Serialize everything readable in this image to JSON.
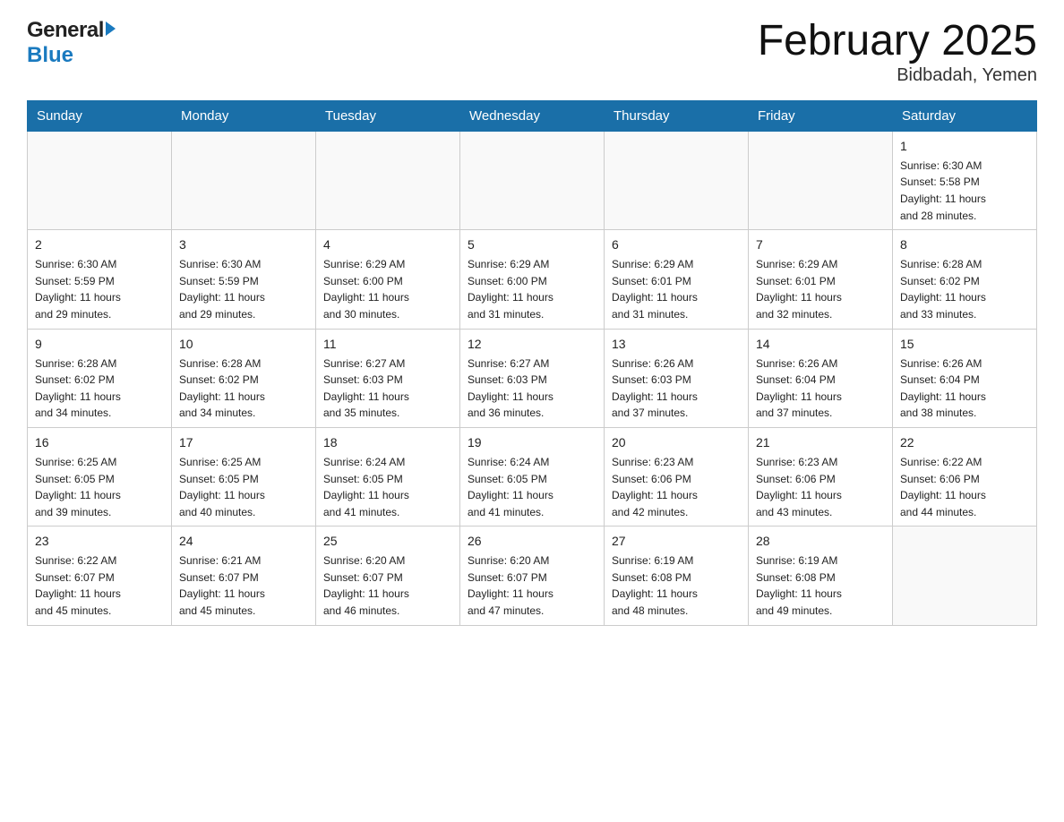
{
  "header": {
    "logo_general": "General",
    "logo_blue": "Blue",
    "month_title": "February 2025",
    "location": "Bidbadah, Yemen"
  },
  "weekdays": [
    "Sunday",
    "Monday",
    "Tuesday",
    "Wednesday",
    "Thursday",
    "Friday",
    "Saturday"
  ],
  "weeks": [
    [
      {
        "day": "",
        "info": ""
      },
      {
        "day": "",
        "info": ""
      },
      {
        "day": "",
        "info": ""
      },
      {
        "day": "",
        "info": ""
      },
      {
        "day": "",
        "info": ""
      },
      {
        "day": "",
        "info": ""
      },
      {
        "day": "1",
        "info": "Sunrise: 6:30 AM\nSunset: 5:58 PM\nDaylight: 11 hours\nand 28 minutes."
      }
    ],
    [
      {
        "day": "2",
        "info": "Sunrise: 6:30 AM\nSunset: 5:59 PM\nDaylight: 11 hours\nand 29 minutes."
      },
      {
        "day": "3",
        "info": "Sunrise: 6:30 AM\nSunset: 5:59 PM\nDaylight: 11 hours\nand 29 minutes."
      },
      {
        "day": "4",
        "info": "Sunrise: 6:29 AM\nSunset: 6:00 PM\nDaylight: 11 hours\nand 30 minutes."
      },
      {
        "day": "5",
        "info": "Sunrise: 6:29 AM\nSunset: 6:00 PM\nDaylight: 11 hours\nand 31 minutes."
      },
      {
        "day": "6",
        "info": "Sunrise: 6:29 AM\nSunset: 6:01 PM\nDaylight: 11 hours\nand 31 minutes."
      },
      {
        "day": "7",
        "info": "Sunrise: 6:29 AM\nSunset: 6:01 PM\nDaylight: 11 hours\nand 32 minutes."
      },
      {
        "day": "8",
        "info": "Sunrise: 6:28 AM\nSunset: 6:02 PM\nDaylight: 11 hours\nand 33 minutes."
      }
    ],
    [
      {
        "day": "9",
        "info": "Sunrise: 6:28 AM\nSunset: 6:02 PM\nDaylight: 11 hours\nand 34 minutes."
      },
      {
        "day": "10",
        "info": "Sunrise: 6:28 AM\nSunset: 6:02 PM\nDaylight: 11 hours\nand 34 minutes."
      },
      {
        "day": "11",
        "info": "Sunrise: 6:27 AM\nSunset: 6:03 PM\nDaylight: 11 hours\nand 35 minutes."
      },
      {
        "day": "12",
        "info": "Sunrise: 6:27 AM\nSunset: 6:03 PM\nDaylight: 11 hours\nand 36 minutes."
      },
      {
        "day": "13",
        "info": "Sunrise: 6:26 AM\nSunset: 6:03 PM\nDaylight: 11 hours\nand 37 minutes."
      },
      {
        "day": "14",
        "info": "Sunrise: 6:26 AM\nSunset: 6:04 PM\nDaylight: 11 hours\nand 37 minutes."
      },
      {
        "day": "15",
        "info": "Sunrise: 6:26 AM\nSunset: 6:04 PM\nDaylight: 11 hours\nand 38 minutes."
      }
    ],
    [
      {
        "day": "16",
        "info": "Sunrise: 6:25 AM\nSunset: 6:05 PM\nDaylight: 11 hours\nand 39 minutes."
      },
      {
        "day": "17",
        "info": "Sunrise: 6:25 AM\nSunset: 6:05 PM\nDaylight: 11 hours\nand 40 minutes."
      },
      {
        "day": "18",
        "info": "Sunrise: 6:24 AM\nSunset: 6:05 PM\nDaylight: 11 hours\nand 41 minutes."
      },
      {
        "day": "19",
        "info": "Sunrise: 6:24 AM\nSunset: 6:05 PM\nDaylight: 11 hours\nand 41 minutes."
      },
      {
        "day": "20",
        "info": "Sunrise: 6:23 AM\nSunset: 6:06 PM\nDaylight: 11 hours\nand 42 minutes."
      },
      {
        "day": "21",
        "info": "Sunrise: 6:23 AM\nSunset: 6:06 PM\nDaylight: 11 hours\nand 43 minutes."
      },
      {
        "day": "22",
        "info": "Sunrise: 6:22 AM\nSunset: 6:06 PM\nDaylight: 11 hours\nand 44 minutes."
      }
    ],
    [
      {
        "day": "23",
        "info": "Sunrise: 6:22 AM\nSunset: 6:07 PM\nDaylight: 11 hours\nand 45 minutes."
      },
      {
        "day": "24",
        "info": "Sunrise: 6:21 AM\nSunset: 6:07 PM\nDaylight: 11 hours\nand 45 minutes."
      },
      {
        "day": "25",
        "info": "Sunrise: 6:20 AM\nSunset: 6:07 PM\nDaylight: 11 hours\nand 46 minutes."
      },
      {
        "day": "26",
        "info": "Sunrise: 6:20 AM\nSunset: 6:07 PM\nDaylight: 11 hours\nand 47 minutes."
      },
      {
        "day": "27",
        "info": "Sunrise: 6:19 AM\nSunset: 6:08 PM\nDaylight: 11 hours\nand 48 minutes."
      },
      {
        "day": "28",
        "info": "Sunrise: 6:19 AM\nSunset: 6:08 PM\nDaylight: 11 hours\nand 49 minutes."
      },
      {
        "day": "",
        "info": ""
      }
    ]
  ]
}
